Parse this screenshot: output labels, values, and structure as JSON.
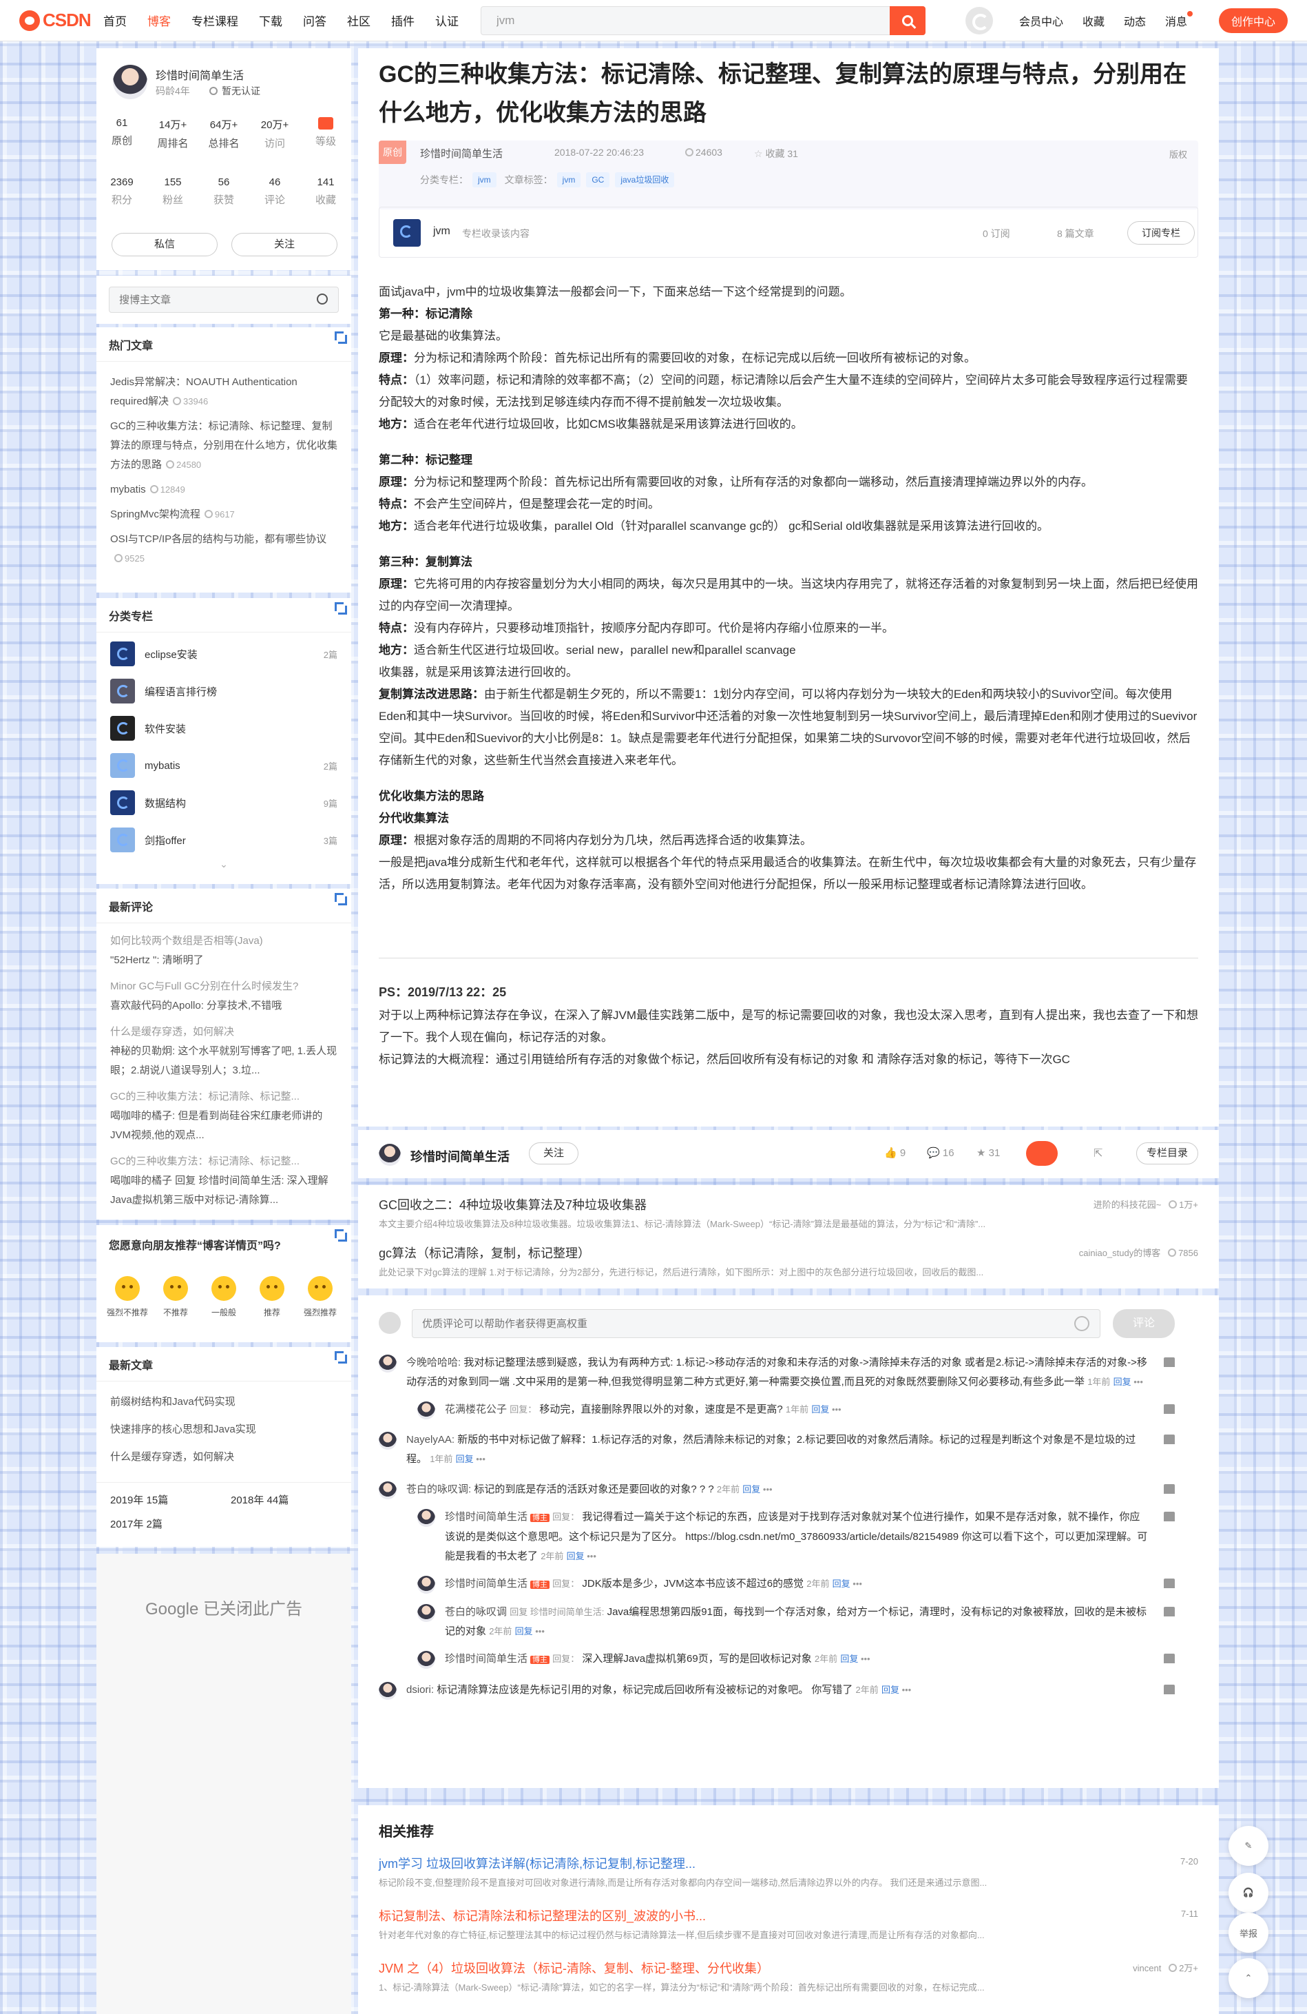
{
  "topbar": {
    "logo": "CSDN",
    "nav": [
      "首页",
      "博客",
      "专栏课程",
      "下载",
      "问答",
      "社区",
      "插件",
      "认证"
    ],
    "search_value": "jvm",
    "right": [
      "会员中心",
      "收藏",
      "动态",
      "消息"
    ],
    "create": "创作中心"
  },
  "profile": {
    "name": "珍惜时间简单生活",
    "age": "码龄4年",
    "verified": "暂无认证",
    "stats1": [
      {
        "v": "61",
        "l": "原创"
      },
      {
        "v": "14万+",
        "l": "周排名"
      },
      {
        "v": "64万+",
        "l": "总排名"
      },
      {
        "v": "20万+",
        "l": "访问"
      },
      {
        "v": "",
        "l": "等级"
      }
    ],
    "stats2": [
      {
        "v": "2369",
        "l": "积分"
      },
      {
        "v": "155",
        "l": "粉丝"
      },
      {
        "v": "56",
        "l": "获赞"
      },
      {
        "v": "46",
        "l": "评论"
      },
      {
        "v": "141",
        "l": "收藏"
      }
    ],
    "msg": "私信",
    "follow": "关注"
  },
  "side_search": "搜博主文章",
  "hot": {
    "title": "热门文章",
    "items": [
      {
        "t": "Jedis异常解决：NOAUTH Authentication required解决",
        "v": "33946"
      },
      {
        "t": "GC的三种收集方法：标记清除、标记整理、复制算法的原理与特点，分别用在什么地方，优化收集方法的思路",
        "v": "24580"
      },
      {
        "t": "mybatis",
        "v": "12849"
      },
      {
        "t": "SpringMvc架构流程",
        "v": "9617"
      },
      {
        "t": "OSI与TCP/IP各层的结构与功能，都有哪些协议",
        "v": "9525"
      }
    ]
  },
  "cats": {
    "title": "分类专栏",
    "items": [
      {
        "n": "eclipse安装",
        "c": "2篇"
      },
      {
        "n": "编程语言排行榜",
        "c": ""
      },
      {
        "n": "软件安装",
        "c": ""
      },
      {
        "n": "mybatis",
        "c": "2篇"
      },
      {
        "n": "数据结构",
        "c": "9篇"
      },
      {
        "n": "剑指offer",
        "c": "3篇"
      }
    ]
  },
  "recent_comments": {
    "title": "最新评论",
    "items": [
      {
        "q": "如何比较两个数组是否相等(Java)",
        "a": "\"52Hertz \": 清晰明了"
      },
      {
        "q": "Minor GC与Full GC分别在什么时候发生?",
        "a": "喜欢敲代码的Apollo: 分享技术,不错哦"
      },
      {
        "q": "什么是缓存穿透，如何解决",
        "a": "神秘的贝勒炯: 这个水平就别写博客了吧, 1.丢人现眼；2.胡说八道误导别人；3.垃..."
      },
      {
        "q": "GC的三种收集方法：标记清除、标记整...",
        "a": "喝咖啡的橘子: 但是看到尚硅谷宋红康老师讲的JVM视频,他的观点..."
      },
      {
        "q": "GC的三种收集方法：标记清除、标记整...",
        "a": "喝咖啡的橘子 回复 珍惜时间简单生活: 深入理解Java虚拟机第三版中对标记-清除算..."
      }
    ]
  },
  "feedback": {
    "title": "您愿意向朋友推荐“博客详情页”吗?",
    "opts": [
      "强烈不推荐",
      "不推荐",
      "一般般",
      "推荐",
      "强烈推荐"
    ]
  },
  "latest": {
    "title": "最新文章",
    "items": [
      "前缀树结构和Java代码实现",
      "快速排序的核心思想和Java实现",
      "什么是缓存穿透，如何解决"
    ],
    "arch": [
      "2019年 15篇",
      "2018年 44篇",
      "2017年 2篇"
    ]
  },
  "ad": "Google 已关闭此广告",
  "article": {
    "title": "GC的三种收集方法：标记清除、标记整理、复制算法的原理与特点，分别用在什么地方，优化收集方法的思路",
    "badge": "原创",
    "author": "珍惜时间简单生活",
    "date": "2018-07-22 20:46:23",
    "views": "24603",
    "fav": "收藏 31",
    "copyright": "版权",
    "cat_label": "分类专栏：",
    "cat": "jvm",
    "tag_label": "文章标签：",
    "tags": [
      "jvm",
      "GC",
      "java垃圾回收"
    ],
    "col_name": "jvm",
    "col_desc": "专栏收录该内容",
    "col_sub": "0 订阅",
    "col_count": "8 篇文章",
    "col_btn": "订阅专栏",
    "paras": [
      {
        "t": "面试java中，jvm中的垃圾收集算法一般都会问一下，下面来总结一下这个经常提到的问题。"
      },
      {
        "b": "第一种：标记清除"
      },
      {
        "t": "它是最基础的收集算法。"
      },
      {
        "b": "原理：",
        "t": "分为标记和清除两个阶段：首先标记出所有的需要回收的对象，在标记完成以后统一回收所有被标记的对象。"
      },
      {
        "b": "特点：",
        "t": "（1）效率问题，标记和清除的效率都不高；（2）空间的问题，标记清除以后会产生大量不连续的空间碎片，空间碎片太多可能会导致程序运行过程需要分配较大的对象时候，无法找到足够连续内存而不得不提前触发一次垃圾收集。"
      },
      {
        "b": "地方：",
        "t": "适合在老年代进行垃圾回收，比如CMS收集器就是采用该算法进行回收的。"
      },
      {
        "gap": 1
      },
      {
        "b": "第二种：标记整理"
      },
      {
        "b": "原理：",
        "t": "分为标记和整理两个阶段：首先标记出所有需要回收的对象，让所有存活的对象都向一端移动，然后直接清理掉端边界以外的内存。"
      },
      {
        "b": "特点：",
        "t": "不会产生空间碎片，但是整理会花一定的时间。"
      },
      {
        "b": "地方：",
        "t": "适合老年代进行垃圾收集，parallel Old（针对parallel scanvange gc的） gc和Serial old收集器就是采用该算法进行回收的。"
      },
      {
        "gap": 1
      },
      {
        "b": "第三种：复制算法"
      },
      {
        "b": "原理：",
        "t": "它先将可用的内存按容量划分为大小相同的两块，每次只是用其中的一块。当这块内存用完了，就将还存活着的对象复制到另一块上面，然后把已经使用过的内存空间一次清理掉。"
      },
      {
        "b": "特点：",
        "t": "没有内存碎片，只要移动堆顶指针，按顺序分配内存即可。代价是将内存缩小位原来的一半。"
      },
      {
        "b": "地方：",
        "t": "适合新生代区进行垃圾回收。serial new，parallel new和parallel scanvage"
      },
      {
        "t": "收集器，就是采用该算法进行回收的。"
      },
      {
        "b": "复制算法改进思路：",
        "t": "由于新生代都是朝生夕死的，所以不需要1：1划分内存空间，可以将内存划分为一块较大的Eden和两块较小的Suvivor空间。每次使用Eden和其中一块Survivor。当回收的时候，将Eden和Survivor中还活着的对象一次性地复制到另一块Survivor空间上，最后清理掉Eden和刚才使用过的Suevivor空间。其中Eden和Suevivor的大小比例是8：1。缺点是需要老年代进行分配担保，如果第二块的Survovor空间不够的时候，需要对老年代进行垃圾回收，然后存储新生代的对象，这些新生代当然会直接进入来老年代。"
      },
      {
        "gap": 1
      },
      {
        "b": "优化收集方法的思路"
      },
      {
        "b": "分代收集算法"
      },
      {
        "b": "原理：",
        "t": "根据对象存活的周期的不同将内存划分为几块，然后再选择合适的收集算法。"
      },
      {
        "t": "一般是把java堆分成新生代和老年代，这样就可以根据各个年代的特点采用最适合的收集算法。在新生代中，每次垃圾收集都会有大量的对象死去，只有少量存活，所以选用复制算法。老年代因为对象存活率高，没有额外空间对他进行分配担保，所以一般采用标记整理或者标记清除算法进行回收。"
      }
    ],
    "ps_title": "PS：2019/7/13 22：25",
    "ps": [
      "对于以上两种标记算法存在争议，在深入了解JVM最佳实践第二版中，是写的标记需要回收的对象，我也没太深入思考，直到有人提出来，我也去查了一下和想了一下。我个人现在偏向，标记存活的对象。",
      "标记算法的大概流程：通过引用链给所有存活的对象做个标记，然后回收所有没有标记的对象 和 清除存活对象的标记，等待下一次GC"
    ]
  },
  "toolbar": {
    "author": "珍惜时间简单生活",
    "follow": "关注",
    "likes": "9",
    "comments": "16",
    "stars": "31",
    "dir": "专栏目录"
  },
  "recs1": [
    {
      "t": "GC回收之二：4种垃圾收集算法及7种垃圾收集器",
      "src": "进阶的科技花园~",
      "v": "1万+",
      "d": "本文主要介绍4种垃圾收集算法及8种垃圾收集器。垃圾收集算法1、标记-清除算法（Mark-Sweep）“标记-清除”算法是最基础的算法，分为“标记”和“清除”..."
    },
    {
      "t": "gc算法（标记清除，复制，标记整理）",
      "src": "cainiao_study的博客",
      "v": "7856",
      "d": "此处记录下对gc算法的理解 1.对于标记清除，分为2部分，先进行标记，然后进行清除，如下图所示：对上图中的灰色部分进行垃圾回收，回收后的截图..."
    }
  ],
  "comment_box": {
    "placeholder": "优质评论可以帮助作者获得更高权重",
    "btn": "评论"
  },
  "comments": [
    {
      "u": "今晚哈哈哈:",
      "t": "我对标记整理法感到疑惑，我认为有两种方式: 1.标记->移动存活的对象和未存活的对象->清除掉未存活的对象 或者是2.标记->清除掉未存活的对象->移动存活的对象到同一端 .文中采用的是第一种,但我觉得明显第二种方式更好,第一种需要交换位置,而且死的对象既然要删除又何必要移动,有些多此一举",
      "time": "1年前",
      "r": "回复",
      "replies": [
        {
          "u": "花满楼花公子",
          "tag": "",
          "to": "回复：",
          "t": "移动完，直接删除界限以外的对象，速度是不是更高?",
          "time": "1年前",
          "r": "回复"
        }
      ]
    },
    {
      "u": "NayelyAA:",
      "t": "新版的书中对标记做了解释：1.标记存活的对象，然后清除未标记的对象；2.标记要回收的对象然后清除。标记的过程是判断这个对象是不是垃圾的过程。",
      "time": "1年前",
      "r": "回复",
      "replies": []
    },
    {
      "u": "苍白的咏叹调:",
      "t": "标记的到底是存活的活跃对象还是要回收的对象? ? ?",
      "time": "2年前",
      "r": "回复",
      "replies": [
        {
          "u": "珍惜时间简单生活",
          "tag": "博主",
          "to": "回复：",
          "t": "我记得看过一篇关于这个标记的东西，应该是对于找到存活对象就对某个位进行操作，如果不是存活对象，就不操作，你应该说的是类似这个意思吧。这个标记只是为了区分。 https://blog.csdn.net/m0_37860933/article/details/82154989 你这可以看下这个，可以更加深理解。可能是我看的书太老了",
          "time": "2年前",
          "r": "回复"
        },
        {
          "u": "珍惜时间简单生活",
          "tag": "博主",
          "to": "回复：",
          "t": "JDK版本是多少，JVM这本书应该不超过6的感觉",
          "time": "2年前",
          "r": "回复"
        },
        {
          "u": "苍白的咏叹调",
          "tag": "",
          "to": "回复 珍惜时间简单生活:",
          "t": "Java编程思想第四版91面，每找到一个存活对象，给对方一个标记，清理时，没有标记的对象被释放，回收的是未被标记的对象",
          "time": "2年前",
          "r": "回复"
        },
        {
          "u": "珍惜时间简单生活",
          "tag": "博主",
          "to": "回复：",
          "t": "深入理解Java虚拟机第69页，写的是回收标记对象",
          "time": "2年前",
          "r": "回复"
        }
      ]
    },
    {
      "u": "dsiori:",
      "t": "标记清除算法应该是先标记引用的对象，标记完成后回收所有没被标记的对象吧。 你写错了",
      "time": "2年前",
      "r": "回复",
      "replies": []
    }
  ],
  "related": {
    "title": "相关推荐",
    "items": [
      {
        "t": "jvm学习 垃圾回收算法详解(标记清除,标记复制,标记整理...",
        "src": "",
        "v": "7-20",
        "d": "标记阶段不变,但整理阶段不是直接对可回收对象进行清除,而是让所有存活对象都向内存空间一端移动,然后清除边界以外的内存。 我们还是来通过示意图..."
      },
      {
        "t": "标记复制法、标记清除法和标记整理法的区别_波波的小书...",
        "src": "",
        "v": "7-11",
        "d": "针对老年代对象的存亡特征,标记整理法其中的标记过程仍然与标记清除算法一样,但后续步骤不是直接对可回收对象进行清理,而是让所有存活的对象都向..."
      },
      {
        "t": "JVM 之（4）垃圾回收算法（标记-清除、复制、标记-整理、分代收集）",
        "src": "vincent",
        "v": "2万+",
        "d": "1、标记-清除算法（Mark-Sweep）“标记-清除”算法，如它的名字一样，算法分为“标记”和“清除”两个阶段：首先标记出所有需要回收的对象，在标记完成..."
      }
    ]
  },
  "float": {
    "report": "举报"
  }
}
